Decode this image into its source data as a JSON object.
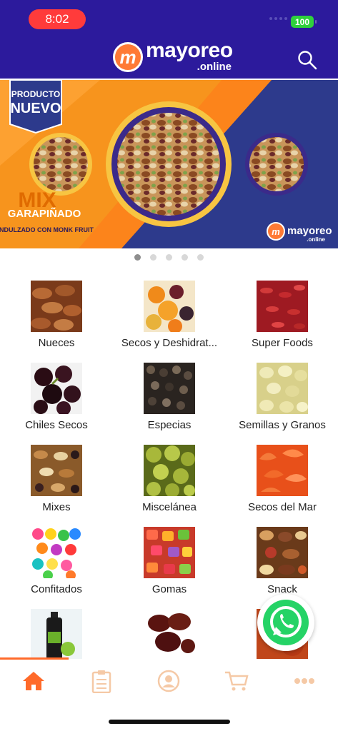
{
  "status_bar": {
    "time": "8:02",
    "battery": "100"
  },
  "header": {
    "logo_name": "mayoreo",
    "logo_sub": ".online"
  },
  "banner": {
    "badge_line1": "PRODUCTO",
    "badge_line2": "NUEVO",
    "product_word": "MIX",
    "product_name": "GARAPIÑADO",
    "product_sub": "ENDULZADO CON MONK FRUIT",
    "brand": "mayoreo",
    "brand_sub": ".online"
  },
  "carousel": {
    "pages": 5,
    "active": 1
  },
  "categories": [
    {
      "label": "Nueces",
      "icon": "pecans"
    },
    {
      "label": "Secos y Deshidrat...",
      "icon": "dried-fruit"
    },
    {
      "label": "Super Foods",
      "icon": "goji"
    },
    {
      "label": "Chiles Secos",
      "icon": "dried-chiles"
    },
    {
      "label": "Especias",
      "icon": "peppercorns"
    },
    {
      "label": "Semillas y Granos",
      "icon": "corn-kernels"
    },
    {
      "label": "Mixes",
      "icon": "trail-mix"
    },
    {
      "label": "Miscelánea",
      "icon": "olives"
    },
    {
      "label": "Secos del Mar",
      "icon": "dried-shrimp"
    },
    {
      "label": "Confitados",
      "icon": "candy-coated"
    },
    {
      "label": "Gomas",
      "icon": "gummies"
    },
    {
      "label": "Snack",
      "icon": "snack-mix"
    },
    {
      "label": "",
      "icon": "bottle-product"
    },
    {
      "label": "",
      "icon": "dark-dried-fruit"
    },
    {
      "label": "",
      "icon": "chile-powder"
    }
  ],
  "tabbar": [
    {
      "name": "home",
      "icon": "home-icon"
    },
    {
      "name": "orders",
      "icon": "clipboard-icon"
    },
    {
      "name": "account",
      "icon": "user-icon"
    },
    {
      "name": "cart",
      "icon": "cart-icon"
    },
    {
      "name": "more",
      "icon": "more-icon"
    }
  ],
  "colors": {
    "header": "#2c1a9c",
    "accent": "#ff6a2a",
    "tab_icon": "#f5c9a6",
    "whatsapp": "#25d366"
  }
}
